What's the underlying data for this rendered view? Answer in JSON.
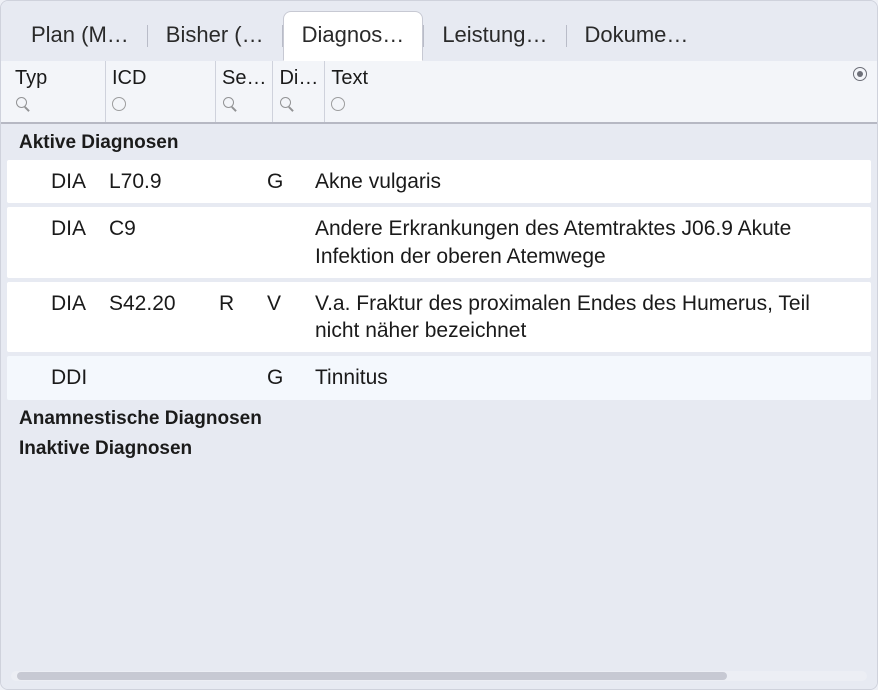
{
  "tabs": {
    "plan": {
      "label": "Plan (M…"
    },
    "bisher": {
      "label": "Bisher (…"
    },
    "diagnos": {
      "label": "Diagnos…"
    },
    "leistung": {
      "label": "Leistung…"
    },
    "dokume": {
      "label": "Dokume…"
    }
  },
  "columns": {
    "typ": {
      "label": "Typ",
      "filter": "search"
    },
    "icd": {
      "label": "ICD",
      "filter": "circle"
    },
    "se": {
      "label": "Se…",
      "filter": "search"
    },
    "di": {
      "label": "Di…",
      "filter": "search"
    },
    "text": {
      "label": "Text",
      "filter": "circle"
    }
  },
  "sections": {
    "aktive": {
      "title": "Aktive Diagnosen"
    },
    "anamnestisch": {
      "title": "Anamnestische Diagnosen"
    },
    "inaktiv": {
      "title": "Inaktive Diagnosen"
    }
  },
  "aktive_rows": [
    {
      "typ": "DIA",
      "icd": "L70.9",
      "se": "",
      "di": "G",
      "text": "Akne vulgaris"
    },
    {
      "typ": "DIA",
      "icd": "C9",
      "se": "",
      "di": "",
      "text": "Andere Erkrankungen des Atemtraktes J06.9 Akute Infektion der oberen Atemwege"
    },
    {
      "typ": "DIA",
      "icd": "S42.20",
      "se": "R",
      "di": "V",
      "text": "V.a. Fraktur des proximalen Endes des Humerus, Teil nicht näher bezeichnet"
    },
    {
      "typ": "DDI",
      "icd": "",
      "se": "",
      "di": "G",
      "text": "Tinnitus"
    }
  ]
}
